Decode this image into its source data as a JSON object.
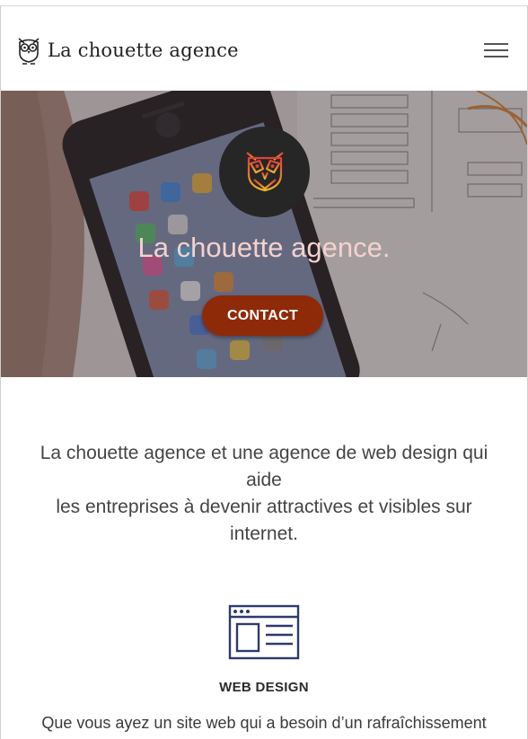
{
  "header": {
    "brand_name": "La chouette agence",
    "logo_icon": "owl-icon",
    "menu_icon": "hamburger-menu-icon"
  },
  "hero": {
    "title": "La chouette agence.",
    "badge_icon": "owl-icon",
    "cta_label": "CONTACT",
    "colors": {
      "cta": "#8f2a08",
      "title": "#f3d2cf",
      "badge": "#262626"
    }
  },
  "intro": {
    "line1": "La chouette agence et une agence de web design qui aide",
    "line2": "les entreprises à devenir attractives et visibles sur internet."
  },
  "services": [
    {
      "icon": "web-page-layout-icon",
      "title": "WEB DESIGN",
      "text": "Que vous ayez un site web qui a besoin d’un rafraîchissement"
    }
  ]
}
